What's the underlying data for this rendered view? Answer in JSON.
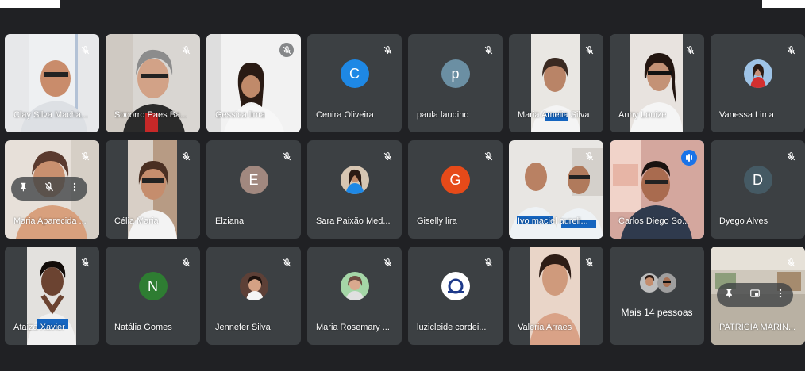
{
  "meeting": {
    "tiles": [
      {
        "name": "Clay Silva Macha...",
        "type": "video",
        "muted": true
      },
      {
        "name": "Socorro Paes Ba...",
        "type": "video",
        "muted": true
      },
      {
        "name": "Gessica lima",
        "type": "video",
        "muted": true
      },
      {
        "name": "Cenira Oliveira",
        "type": "avatar",
        "letter": "C",
        "color": "#1e88e5",
        "muted": true
      },
      {
        "name": "paula laudino",
        "type": "avatar",
        "letter": "p",
        "color": "#6b8fa3",
        "muted": true
      },
      {
        "name": "Maria Amelia Silva",
        "type": "video",
        "muted": true
      },
      {
        "name": "Anny Louize",
        "type": "video",
        "muted": true
      },
      {
        "name": "Vanessa Lima",
        "type": "photo",
        "muted": true
      },
      {
        "name": "Maria Aparecida ...",
        "type": "video",
        "muted": true
      },
      {
        "name": "Célia Maria",
        "type": "video",
        "muted": true
      },
      {
        "name": "Elziana",
        "type": "avatar",
        "letter": "E",
        "color": "#a1887f",
        "muted": true
      },
      {
        "name": "Sara Paixão Med...",
        "type": "photo",
        "muted": true
      },
      {
        "name": "Giselly lira",
        "type": "avatar",
        "letter": "G",
        "color": "#e64a19",
        "muted": true
      },
      {
        "name": "Ivo maciel aureli...",
        "type": "video",
        "muted": true
      },
      {
        "name": "Carlos Diego So...",
        "type": "video",
        "muted": false,
        "speaking": true
      },
      {
        "name": "Dyego Alves",
        "type": "avatar",
        "letter": "D",
        "color": "#455a64",
        "muted": true
      },
      {
        "name": "Ataiza Xavier",
        "type": "video",
        "muted": true
      },
      {
        "name": "Natália Gomes",
        "type": "avatar",
        "letter": "N",
        "color": "#2e7d32",
        "muted": true
      },
      {
        "name": "Jennefer Silva",
        "type": "photo",
        "muted": true
      },
      {
        "name": "Maria Rosemary ...",
        "type": "photo",
        "muted": true
      },
      {
        "name": "luzicleide cordei...",
        "type": "photo",
        "muted": true
      },
      {
        "name": "Valeria Arraes",
        "type": "video",
        "muted": true
      },
      {
        "name": "Mais 14 pessoas",
        "type": "more"
      },
      {
        "name": "PATRÍCIA MARIN...",
        "type": "video",
        "muted": true
      }
    ]
  },
  "icons": {
    "mute": "mic-off-icon",
    "speaking": "audio-level-icon",
    "pin": "pin-icon",
    "more": "more-vert-icon",
    "frame": "picture-in-picture-icon"
  },
  "colors": {
    "background": "#202124",
    "tile": "#3c4043",
    "active_border": "#8ab4f8",
    "speaking": "#1a73e8"
  }
}
